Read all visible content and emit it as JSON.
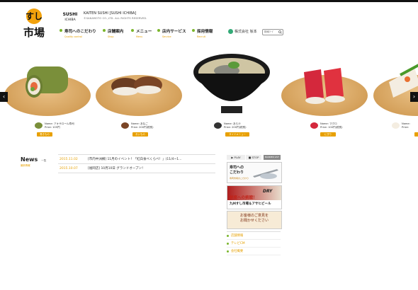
{
  "header": {
    "logo_alt": "すし市場",
    "sub_logo": "SUSHI ICHIBA",
    "corp_line1": "KAITEN SUSHI [SUSHI ICHIBA]",
    "corp_line2": "©SAKAMOTO CO.,LTD. ALL RIGHTS RESERVED."
  },
  "nav": [
    {
      "jp": "寿司へのこだわり",
      "en": "Quality control"
    },
    {
      "jp": "店舗案内",
      "en": "Shop"
    },
    {
      "jp": "メニュー",
      "en": "Menu"
    },
    {
      "jp": "店内サービス",
      "en": "Service"
    },
    {
      "jp": "採用情報",
      "en": "Recruit"
    }
  ],
  "partner": {
    "label": "株式会社 坂本"
  },
  "search": {
    "placeholder": "検索ﾜｰﾄﾞ"
  },
  "slides": [
    {
      "name": "Name: アオサロール寿司",
      "price": "Price: 105円",
      "button": "巻きもの"
    },
    {
      "name": "Name: あなご",
      "price": "Price: 200円(税別)",
      "button": "おいもの"
    },
    {
      "name": "Name: あら汁",
      "price": "Price: 200円(税別)",
      "button": "サイドメニュー"
    },
    {
      "name": "Name: マグロ",
      "price": "Price: 100円(税別)",
      "button": "にぎり"
    },
    {
      "name": "Name: ",
      "price": "Price: ",
      "button": ""
    }
  ],
  "news": {
    "title": "News",
    "ichiran": "一覧",
    "subtitle": "最新情報",
    "items": [
      {
        "date": "2015.11.02",
        "text": "[市内中洲横] 11月のイベント！「紅白食べくらべ！」(11/4~1..."
      },
      {
        "date": "2015.10.07",
        "text": "[福岡店] 10月10日 グランドオープン！"
      }
    ]
  },
  "side": {
    "play": "PLAY",
    "stop": "STOP",
    "bannerlist": "BANNER LIST",
    "banner1_line1": "寿司への",
    "banner1_line2": "こだわり",
    "banner1_sub": "寿司市場のこだわり",
    "banner2_text": "鮮度への挑戦！",
    "banner2_sub": "九州すし市場＆アサヒビール",
    "banner2_label": "DRY",
    "banner3_line1": "お客様のご意見を",
    "banner3_line2": "お聞かせください",
    "links": [
      "店舗情報",
      "テレビCM",
      "会社概要"
    ]
  },
  "colors": {
    "accent": "#e6a000",
    "nav_dot": "#7bb62c",
    "topbar": "#111111"
  }
}
